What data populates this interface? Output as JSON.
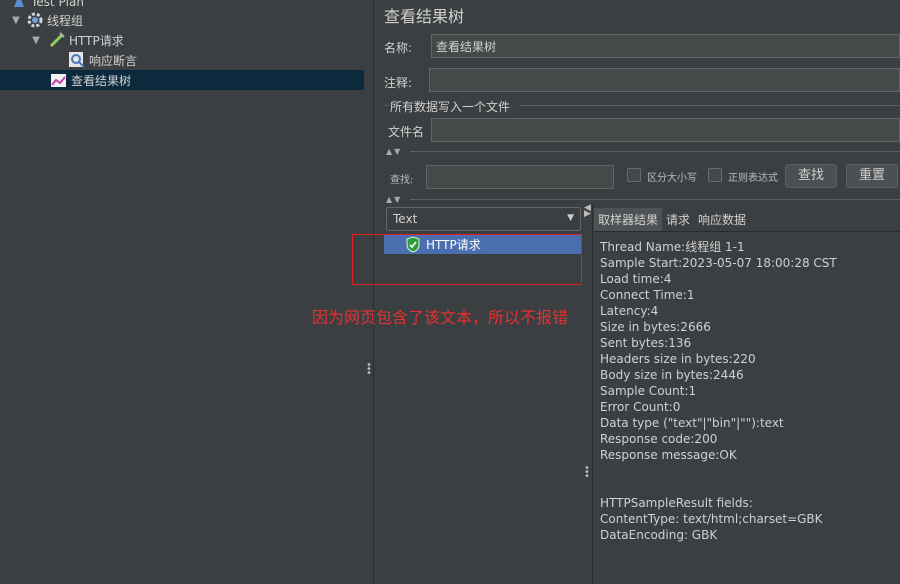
{
  "tree": {
    "items": [
      {
        "label": "Test Plan"
      },
      {
        "label": "线程组"
      },
      {
        "label": "HTTP请求"
      },
      {
        "label": "响应断言"
      },
      {
        "label": "查看结果树"
      }
    ]
  },
  "listener": {
    "title": "查看结果树",
    "name_label": "名称:",
    "name_value": "查看结果树",
    "comment_label": "注释:",
    "comment_value": "",
    "file_group_label": "所有数据写入一个文件",
    "file_label": "文件名",
    "file_value": ""
  },
  "search": {
    "label": "查找:",
    "value": "",
    "case_sensitive_label": "区分大小写",
    "regex_label": "正则表达式",
    "find_button": "查找",
    "reset_button": "重置"
  },
  "renderer": {
    "selected": "Text"
  },
  "results": {
    "items": [
      {
        "label": "HTTP请求",
        "status": "success"
      }
    ]
  },
  "tabs": [
    "取样器结果",
    "请求",
    "响应数据"
  ],
  "sample_result": {
    "lines": [
      "Thread Name:线程组 1-1",
      "Sample Start:2023-05-07 18:00:28 CST",
      "Load time:4",
      "Connect Time:1",
      "Latency:4",
      "Size in bytes:2666",
      "Sent bytes:136",
      "Headers size in bytes:220",
      "Body size in bytes:2446",
      "Sample Count:1",
      "Error Count:0",
      "Data type (\"text\"|\"bin\"|\"\"):text",
      "Response code:200",
      "Response message:OK",
      "",
      "",
      "HTTPSampleResult fields:",
      "ContentType: text/html;charset=GBK",
      "DataEncoding: GBK"
    ]
  },
  "annotation": {
    "text": "因为网页包含了该文本，所以不报错",
    "color": "#e63030"
  }
}
